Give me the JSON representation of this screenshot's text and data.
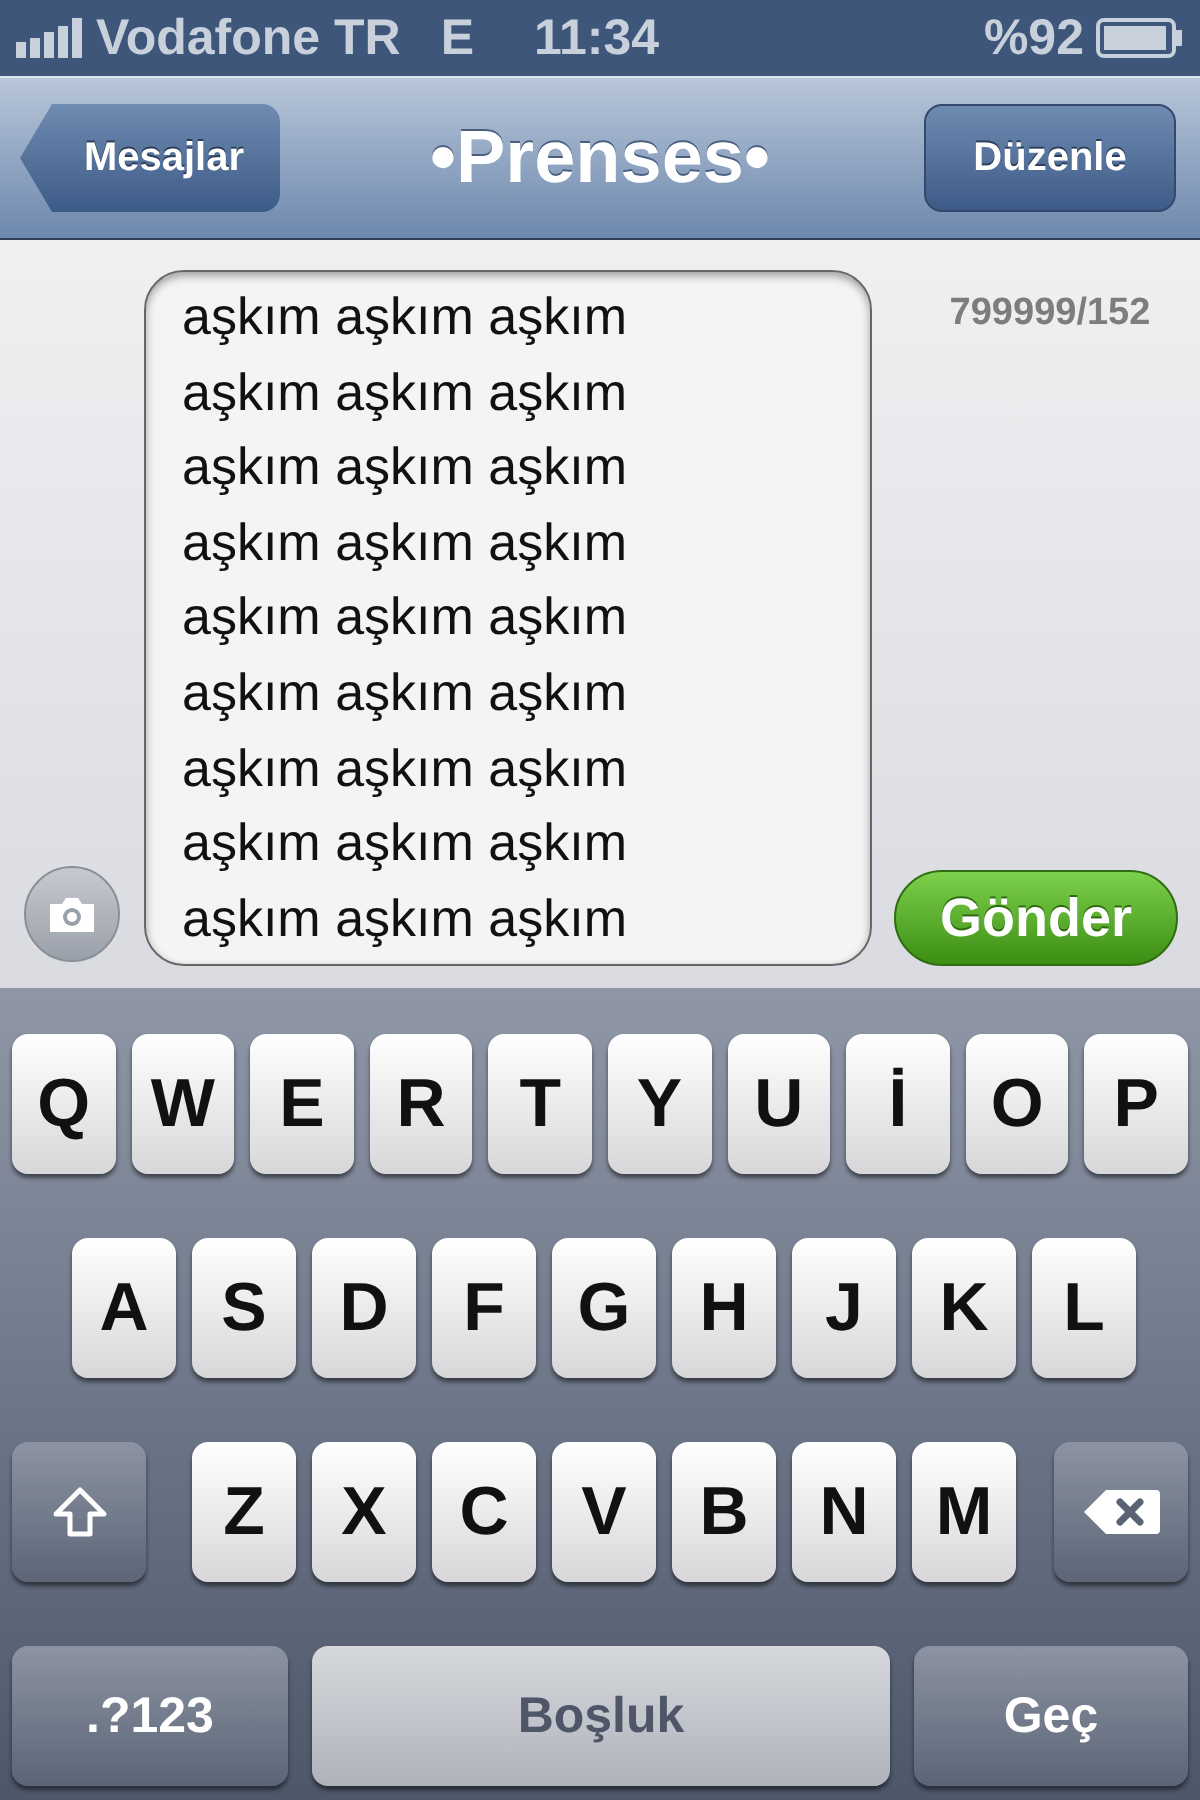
{
  "status_bar": {
    "carrier": "Vodafone TR",
    "network": "E",
    "time": "11:34",
    "battery": "%92"
  },
  "nav": {
    "back": "Mesajlar",
    "title": "•Prenses•",
    "edit": "Düzenle"
  },
  "compose": {
    "lines": [
      "aşkım aşkım aşkım",
      "aşkım aşkım aşkım",
      "aşkım aşkım aşkım",
      "aşkım aşkım aşkım",
      "aşkım aşkım aşkım",
      "aşkım aşkım aşkım",
      "aşkım aşkım aşkım",
      "aşkım aşkım aşkım",
      "aşkım aşkım aşkım"
    ],
    "counter": "799999/152",
    "send": "Gönder"
  },
  "keyboard": {
    "rows": [
      {
        "keys": [
          {
            "kind": "letter",
            "label": "Q"
          },
          {
            "kind": "letter",
            "label": "W"
          },
          {
            "kind": "letter",
            "label": "E"
          },
          {
            "kind": "letter",
            "label": "R"
          },
          {
            "kind": "letter",
            "label": "T"
          },
          {
            "kind": "letter",
            "label": "Y"
          },
          {
            "kind": "letter",
            "label": "U"
          },
          {
            "kind": "letter",
            "label": "İ"
          },
          {
            "kind": "letter",
            "label": "O"
          },
          {
            "kind": "letter",
            "label": "P"
          }
        ]
      },
      {
        "keys": [
          {
            "kind": "letter",
            "label": "A"
          },
          {
            "kind": "letter",
            "label": "S"
          },
          {
            "kind": "letter",
            "label": "D"
          },
          {
            "kind": "letter",
            "label": "F"
          },
          {
            "kind": "letter",
            "label": "G"
          },
          {
            "kind": "letter",
            "label": "H"
          },
          {
            "kind": "letter",
            "label": "J"
          },
          {
            "kind": "letter",
            "label": "K"
          },
          {
            "kind": "letter",
            "label": "L"
          }
        ]
      },
      {
        "keys": [
          {
            "kind": "shift"
          },
          {
            "kind": "letter",
            "label": "Z"
          },
          {
            "kind": "letter",
            "label": "X"
          },
          {
            "kind": "letter",
            "label": "C"
          },
          {
            "kind": "letter",
            "label": "V"
          },
          {
            "kind": "letter",
            "label": "B"
          },
          {
            "kind": "letter",
            "label": "N"
          },
          {
            "kind": "letter",
            "label": "M"
          },
          {
            "kind": "delete"
          }
        ]
      },
      {
        "keys": [
          {
            "kind": "mode",
            "label": ".?123"
          },
          {
            "kind": "space",
            "label": "Boşluk"
          },
          {
            "kind": "return",
            "label": "Geç"
          }
        ]
      }
    ]
  }
}
